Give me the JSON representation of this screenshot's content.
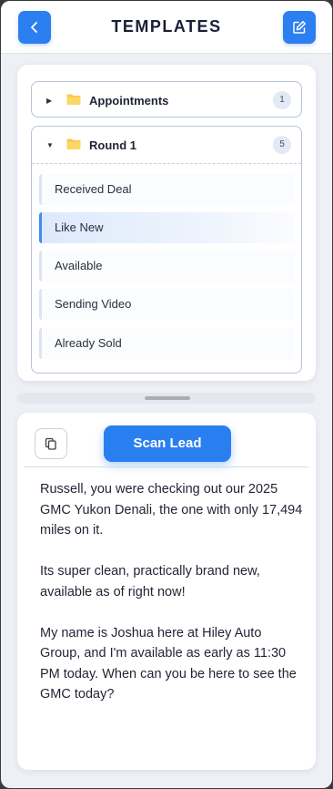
{
  "header": {
    "title": "TEMPLATES",
    "back_icon": "chevron-left-icon",
    "edit_icon": "edit-icon"
  },
  "folders": [
    {
      "name": "Appointments",
      "count": "1",
      "expanded": false
    },
    {
      "name": "Round 1",
      "count": "5",
      "expanded": true,
      "items": [
        {
          "label": "Received Deal",
          "active": false
        },
        {
          "label": "Like New",
          "active": true
        },
        {
          "label": "Available",
          "active": false
        },
        {
          "label": "Sending Video",
          "active": false
        },
        {
          "label": "Already Sold",
          "active": false
        }
      ]
    }
  ],
  "message": {
    "copy_icon": "copy-icon",
    "scan_label": "Scan Lead",
    "text": "Russell, you were checking out our 2025 GMC Yukon Denali, the one with only 17,494 miles on it.\n\nIts super clean, practically brand new, available as of right now!\n\nMy name is Joshua here at Hiley Auto Group, and I'm available as early as 11:30 PM today. When can you be here to see the GMC today?"
  },
  "colors": {
    "accent": "#2b7ff0",
    "folder": "#f7c948",
    "background": "#eef0f5"
  }
}
